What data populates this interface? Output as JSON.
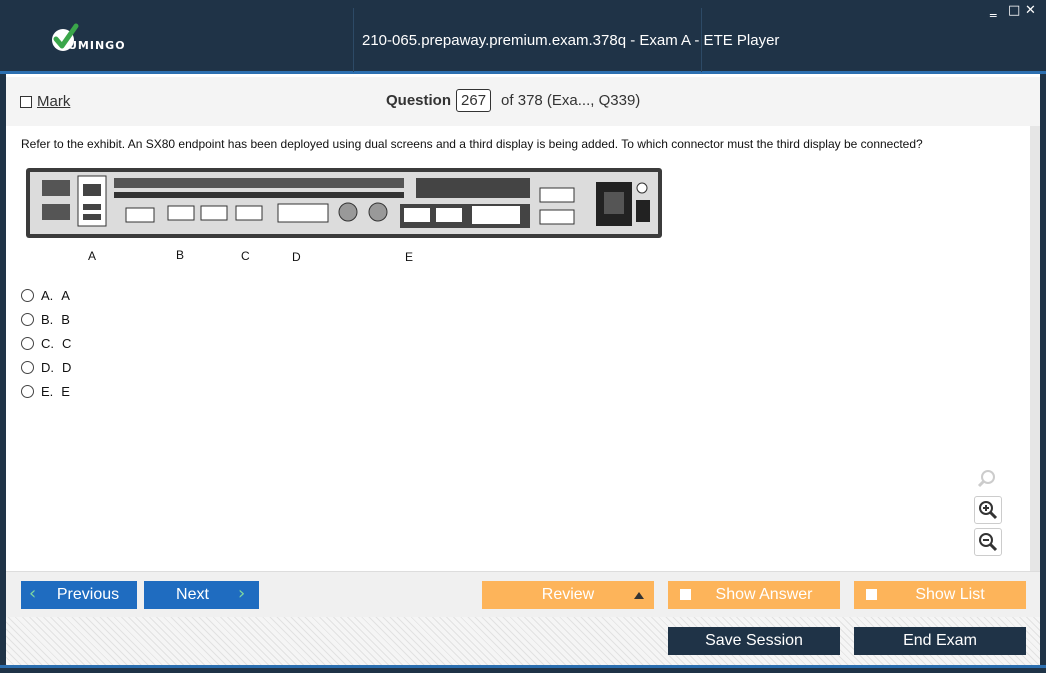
{
  "window": {
    "title": "210-065.prepaway.premium.exam.378q - Exam A - ETE Player",
    "logo_text": "UMINGO",
    "minimize_glyph": "‗",
    "maximize_glyph": "□",
    "close_glyph": "✕"
  },
  "question_bar": {
    "mark_label": "Mark",
    "question_label": "Question",
    "question_number": "267",
    "question_of": "of 378 (Exa..., Q339)"
  },
  "question": {
    "text": "Refer to the exhibit. An SX80 endpoint has been deployed using dual screens and a third display is being added. To which connector must the third display be connected?",
    "connector_labels": [
      "A",
      "B",
      "C",
      "D",
      "E"
    ]
  },
  "answers": [
    {
      "letter": "A.",
      "text": "A"
    },
    {
      "letter": "B.",
      "text": "B"
    },
    {
      "letter": "C.",
      "text": "C"
    },
    {
      "letter": "D.",
      "text": "D"
    },
    {
      "letter": "E.",
      "text": "E"
    }
  ],
  "toolbar": {
    "previous": "Previous",
    "next": "Next",
    "review": "Review",
    "show_answer": "Show Answer",
    "show_list": "Show List",
    "save_session": "Save Session",
    "end_exam": "End Exam"
  },
  "icons": {
    "logo": "check-logo-icon",
    "zoom_fit": "magnifier-icon",
    "zoom_in": "zoom-in-icon",
    "zoom_out": "zoom-out-icon",
    "prev": "chevron-left-icon",
    "next": "chevron-right-icon",
    "review_dropdown": "triangle-up-icon"
  },
  "colors": {
    "header_bg": "#1f3347",
    "accent_blue": "#1f6cc0",
    "accent_orange": "#fdb45a",
    "logo_green": "#3aa64a"
  }
}
